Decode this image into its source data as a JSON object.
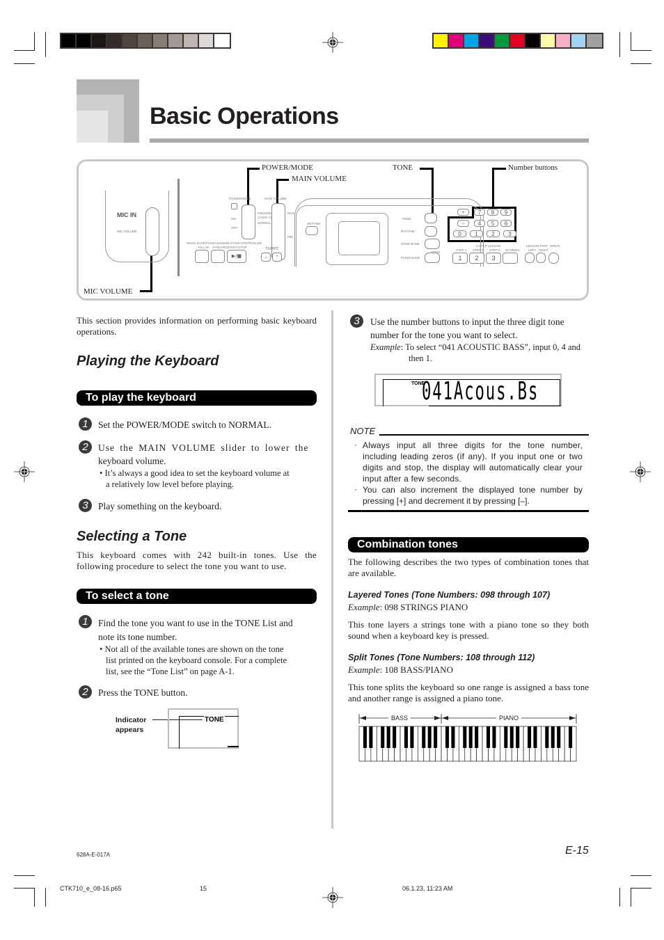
{
  "print_marks": {
    "grayscale_swatches": [
      "#000000",
      "#020000",
      "#1b1715",
      "#352b28",
      "#4f4641",
      "#6a605a",
      "#867d77",
      "#a39a95",
      "#bfb6b1",
      "#ddd9d6",
      "#ffffff"
    ],
    "color_swatches": [
      "#fff200",
      "#e2007a",
      "#00a4e4",
      "#3b0c7a",
      "#009a3e",
      "#e1001f",
      "#000000",
      "#fff9aa",
      "#f7afc9",
      "#9fd4f0",
      "#a0a0a0"
    ]
  },
  "header": {
    "title": "Basic Operations"
  },
  "diagram": {
    "callouts": {
      "power_mode": "POWER/MODE",
      "main_volume": "MAIN VOLUME",
      "tone": "TONE",
      "number_buttons": "Number buttons",
      "mic_volume": "MIC VOLUME"
    },
    "panel_labels": {
      "mic_in": "MIC IN",
      "mic_volume_small": "MIC VOLUME",
      "power_mode_small": "POWER/MODE",
      "main_volume_small": "MAIN VOLUME",
      "on": "ON",
      "off": "OFF",
      "modes": [
        "FINGERED",
        "CASIO CHORD",
        "NORMAL"
      ],
      "max": "MAX",
      "min": "MIN",
      "controller": "SONG BANK/PIANO BANK/RHYTHM CONTROLLER",
      "fill_in": "FILL-IN",
      "synchro": "SYNCHRO",
      "start_stop": "START/STOP",
      "play_stop_glyph": "▶/■",
      "tempo": "TEMPO",
      "setting": "SETTING",
      "tone": "TONE",
      "rhythm": "RHYTHM",
      "song_bank": "SONG BANK",
      "piano_bank": "PIANO BANK",
      "demo": "DEMO",
      "lesson_steps_header": "3-STEP LESSON",
      "steps": [
        "STEP 1",
        "STEP 2",
        "STEP 3",
        "SCORING"
      ],
      "lesson_part": "LESSON PART",
      "left": "LEFT",
      "right": "RIGHT",
      "speak": "SPEAK",
      "plus": "+",
      "minus": "−",
      "keypad": [
        "7",
        "8",
        "9",
        "4",
        "5",
        "6",
        "0",
        "1",
        "2",
        "3"
      ],
      "step_buttons": [
        "1",
        "2",
        "3",
        ""
      ]
    }
  },
  "left_column": {
    "intro": "This section provides information on performing basic keyboard operations.",
    "playing": {
      "heading": "Playing the Keyboard",
      "subheading": "To play the keyboard",
      "steps": [
        {
          "num": "1",
          "text": "Set the POWER/MODE switch to NORMAL."
        },
        {
          "num": "2",
          "text_line1": "Use the MAIN VOLUME slider to lower the",
          "text_line2": "keyboard volume.",
          "bullet_line1": "• It’s always a good idea to set the keyboard volume at",
          "bullet_line2": "a relatively low level before playing."
        },
        {
          "num": "3",
          "text": "Play something on the keyboard."
        }
      ]
    },
    "selecting": {
      "heading": "Selecting a Tone",
      "intro": "This keyboard comes with 242 built-in tones. Use the following procedure to select the tone you want to use.",
      "subheading": "To select a tone",
      "steps": [
        {
          "num": "1",
          "text_line1": "Find the tone you want to use in the TONE List and",
          "text_line2": "note its tone number.",
          "bullet_line1": "• Not all of the available tones are shown on the tone",
          "bullet_line2": "list printed on the keyboard console. For a complete",
          "bullet_line3": "list, see the “Tone List” on page A-1."
        },
        {
          "num": "2",
          "text": "Press the TONE button."
        }
      ],
      "indicator": {
        "label_line1": "Indicator",
        "label_line2": "appears",
        "display_text": "TONE"
      }
    }
  },
  "right_column": {
    "step3": {
      "num": "3",
      "text_line1": "Use the number buttons to input the three digit tone",
      "text_line2": "number for the tone you want to select.",
      "example_label": "Example",
      "example_line1": ": To select “041 ACOUSTIC BASS”, input 0, 4 and",
      "example_line2": "then 1."
    },
    "lcd": {
      "indicator": "TONE",
      "text": "041Acous.Bs"
    },
    "note": {
      "title": "NOTE",
      "items": [
        "Always input all three digits for the tone number, including leading zeros (if any). If you input one or two digits and stop, the display will automatically clear your input after a few seconds.",
        "You can also increment the displayed tone number by pressing [+] and decrement it by pressing [–]."
      ]
    },
    "combination": {
      "subheading": "Combination tones",
      "intro": "The following describes the two types of combination tones that are available.",
      "layered": {
        "heading": "Layered Tones (Tone Numbers: 098 through 107)",
        "example_label": "Example",
        "example_value": ": 098 STRINGS PIANO",
        "description": "This tone layers a strings tone with a piano tone so they both sound when a keyboard key is pressed."
      },
      "split": {
        "heading": "Split Tones (Tone Numbers: 108 through 112)",
        "example_label": "Example",
        "example_value": ": 108 BASS/PIANO",
        "description": "This tone splits the keyboard so one range is assigned a bass tone and another range is assigned a piano tone."
      },
      "piano_diagram": {
        "bass_label": "BASS",
        "piano_label": "PIANO",
        "white_keys": 37,
        "split_after_white_key": 14
      }
    }
  },
  "footer": {
    "code": "628A-E-017A",
    "page_number": "E-15",
    "file": "CTK710_e_08-16.p65",
    "sheet": "15",
    "datetime": "06.1.23, 11:23 AM"
  }
}
